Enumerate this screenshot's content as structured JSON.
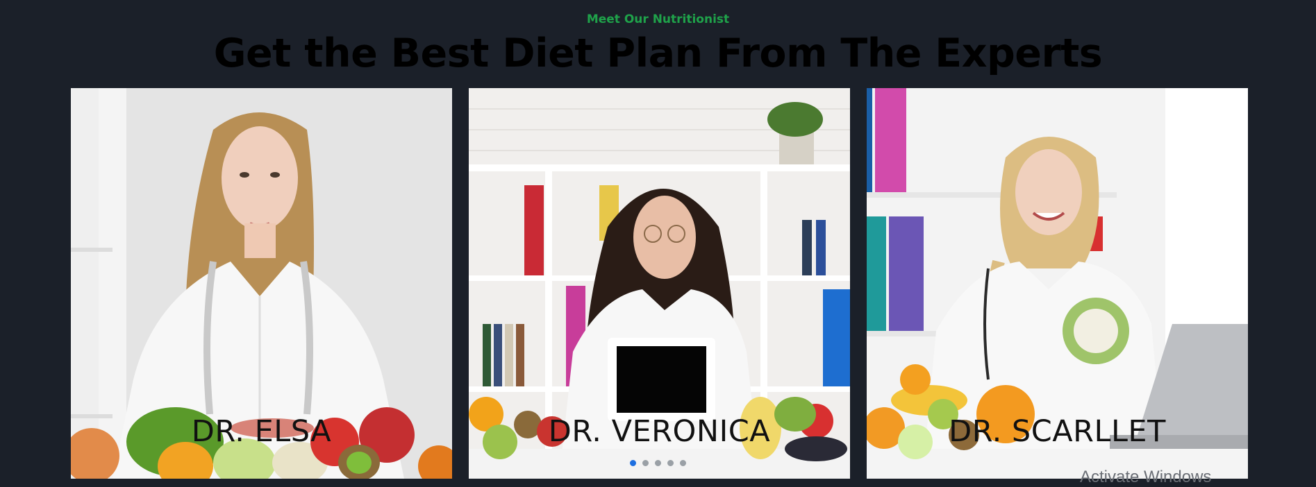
{
  "section": {
    "eyebrow": "Meet Our Nutritionist",
    "title": "Get the Best Diet Plan From The Experts"
  },
  "cards": [
    {
      "name": "DR. ELSA",
      "photo_icon": "nutritionist-photo"
    },
    {
      "name": "DR. VERONICA",
      "photo_icon": "nutritionist-photo"
    },
    {
      "name": "DR. SCARLLET",
      "photo_icon": "nutritionist-photo"
    }
  ],
  "carousel": {
    "pages": 5,
    "active_page": 1
  },
  "overlay": {
    "watermark": "Activate Windows"
  },
  "colors": {
    "background": "#1b2029",
    "accent": "#1fa24a",
    "active_dot": "#1e6fe0"
  }
}
